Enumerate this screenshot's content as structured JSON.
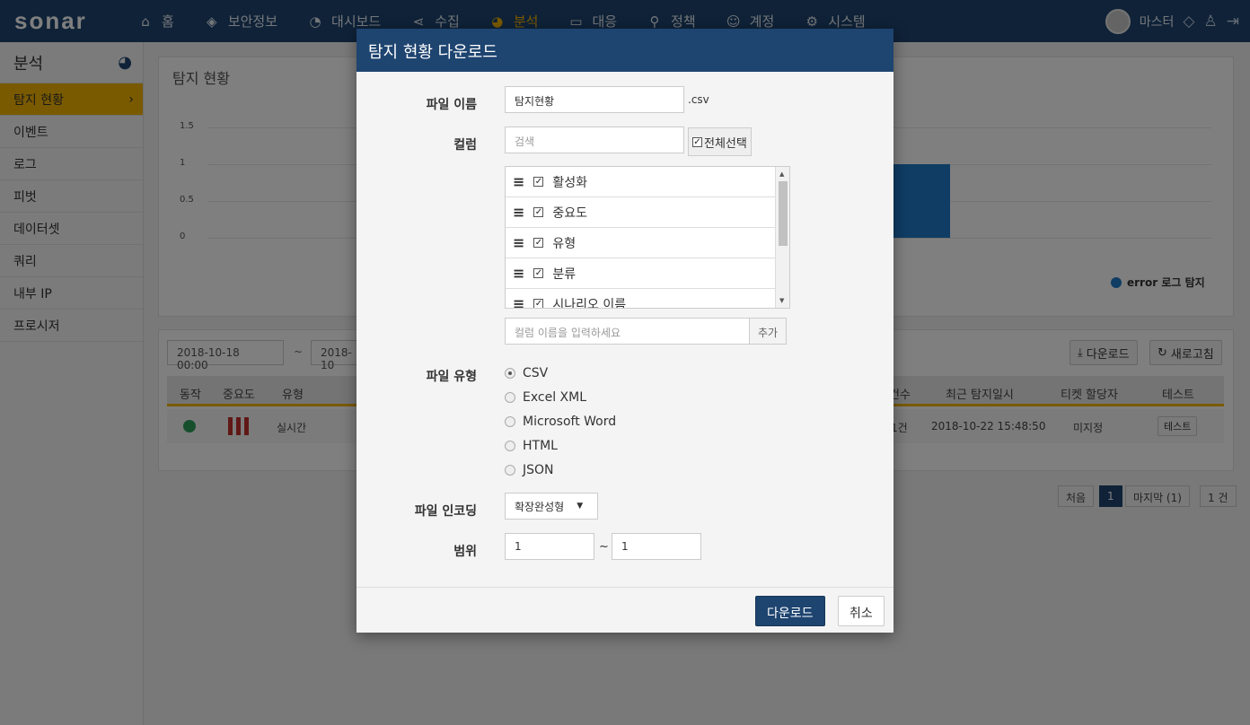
{
  "app": {
    "logo": "sonar"
  },
  "nav": {
    "items": [
      {
        "icon": "home-icon",
        "glyph": "⌂",
        "label": "홈"
      },
      {
        "icon": "shield-icon",
        "glyph": "◈",
        "label": "보안정보"
      },
      {
        "icon": "dashboard-icon",
        "glyph": "◔",
        "label": "대시보드"
      },
      {
        "icon": "share-icon",
        "glyph": "⋖",
        "label": "수집"
      },
      {
        "icon": "pie-chart-icon",
        "glyph": "◕",
        "label": "분석"
      },
      {
        "icon": "laptop-icon",
        "glyph": "▭",
        "label": "대응"
      },
      {
        "icon": "search-icon",
        "glyph": "⚲",
        "label": "정책"
      },
      {
        "icon": "user-circle-icon",
        "glyph": "☺",
        "label": "계정"
      },
      {
        "icon": "gear-icon",
        "glyph": "⚙",
        "label": "시스템"
      }
    ],
    "active_index": 4,
    "user_name": "마스터"
  },
  "sidebar": {
    "title": "분석",
    "items": [
      "탐지 현황",
      "이벤트",
      "로그",
      "피벗",
      "데이터셋",
      "쿼리",
      "내부 IP",
      "프로시저"
    ]
  },
  "main": {
    "chart_title": "탐지 현황",
    "chart_data": {
      "type": "bar",
      "yticks": [
        "1.5",
        "1",
        "0.5",
        "0"
      ],
      "ylim": [
        0,
        1.5
      ],
      "series": [
        {
          "name": "error 로그 탐지",
          "values": [
            1
          ]
        }
      ],
      "color": "#1f7ac8"
    },
    "date_from": "2018-10-18 00:00",
    "date_sep": "~",
    "date_to": "2018-10",
    "download_label": "다운로드",
    "refresh_label": "새로고침",
    "table": {
      "headers": [
        "동작",
        "중요도",
        "유형",
        "건수",
        "최근 탐지일시",
        "티켓 할당자",
        "테스트"
      ],
      "row": {
        "type": "실시간",
        "count": "1건",
        "last_detected": "2018-10-22 15:48:50",
        "assignee": "미지정",
        "test_label": "테스트"
      }
    },
    "pagination": {
      "first": "처음",
      "current": "1",
      "last": "마지막 (1)",
      "total": "1 건"
    }
  },
  "modal": {
    "title": "탐지 현황 다운로드",
    "filename_label": "파일 이름",
    "filename_value": "탐지현황",
    "filename_suffix": ".csv",
    "column_label": "컬럼",
    "column_search_placeholder": "검색",
    "select_all_label": "전체선택",
    "columns": [
      "활성화",
      "중요도",
      "유형",
      "분류",
      "시나리오 이름"
    ],
    "column_name_placeholder": "컬럼 이름을 입력하세요",
    "add_label": "추가",
    "filetype_label": "파일 유형",
    "filetypes": [
      "CSV",
      "Excel XML",
      "Microsoft Word",
      "HTML",
      "JSON"
    ],
    "filetype_selected": "CSV",
    "encoding_label": "파일 인코딩",
    "encoding_value": "확장완성형",
    "range_label": "범위",
    "range_from": "1",
    "range_sep": "~",
    "range_to": "1",
    "download_button": "다운로드",
    "cancel_button": "취소"
  }
}
